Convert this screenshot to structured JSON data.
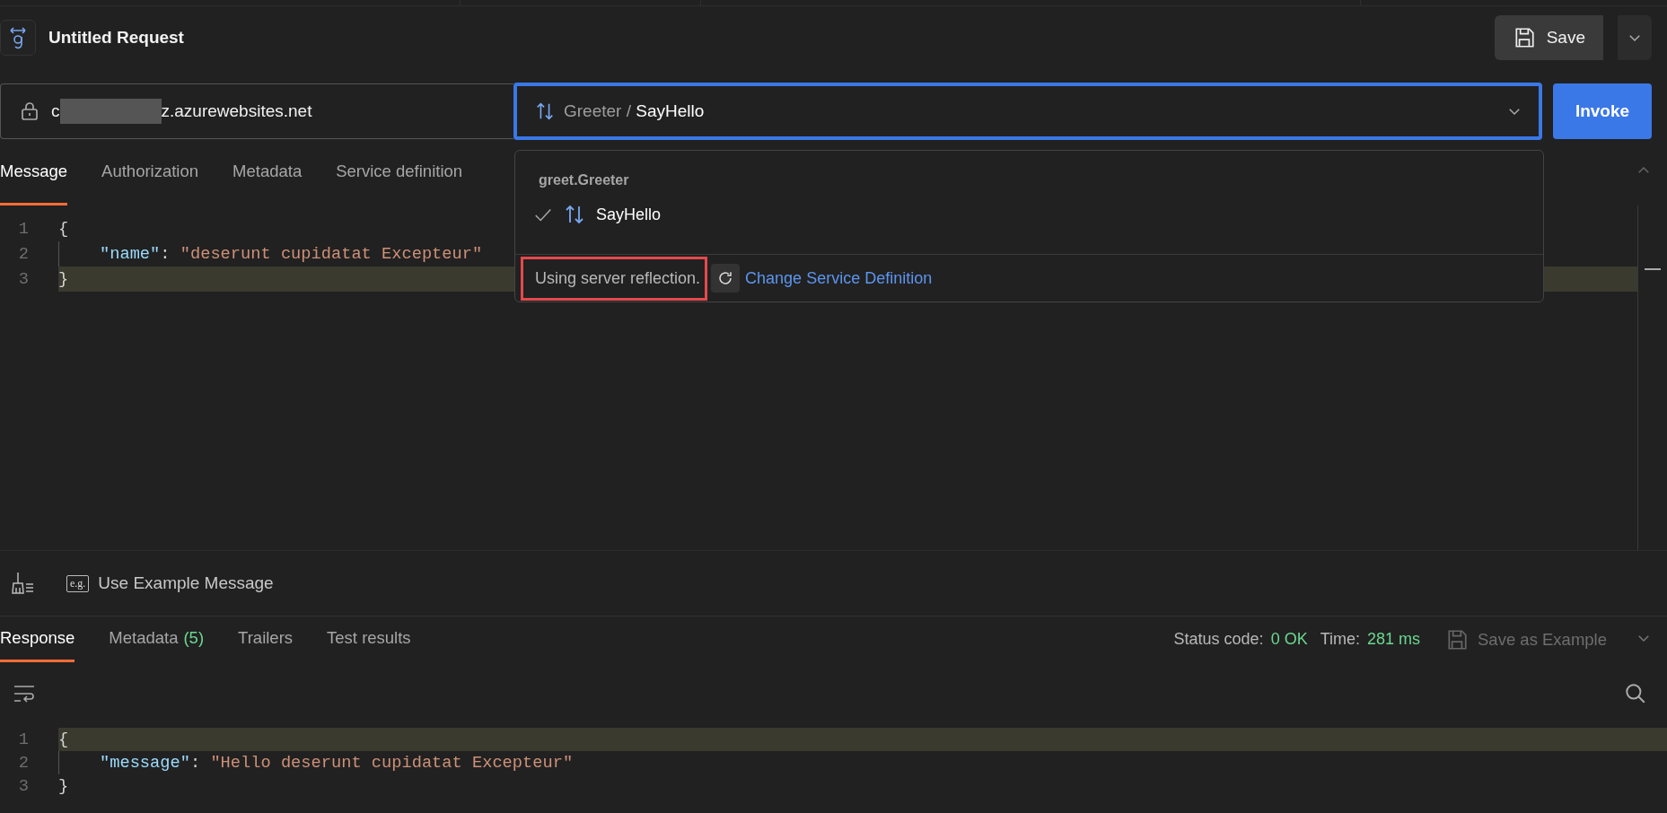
{
  "header": {
    "title": "Untitled Request",
    "save_label": "Save"
  },
  "request": {
    "url": {
      "start": "c",
      "redacted": true,
      "end": "z.azurewebsites.net"
    },
    "method": {
      "service": "Greeter",
      "separator": "/",
      "name": "SayHello"
    },
    "invoke_label": "Invoke"
  },
  "dropdown": {
    "group": "greet.Greeter",
    "items": [
      {
        "label": "SayHello",
        "selected": true
      }
    ],
    "footer": {
      "note": "Using server reflection.",
      "highlighted": true,
      "link": "Change Service Definition"
    }
  },
  "request_tabs": [
    {
      "label": "Message",
      "selected": true
    },
    {
      "label": "Authorization",
      "selected": false
    },
    {
      "label": "Metadata",
      "selected": false
    },
    {
      "label": "Service definition",
      "selected": false
    }
  ],
  "message_editor": {
    "lines": [
      {
        "number": "1",
        "highlighted": false,
        "indented": false,
        "tokens": [
          {
            "kind": "punct",
            "text": "{"
          }
        ]
      },
      {
        "number": "2",
        "highlighted": false,
        "indented": true,
        "tokens": [
          {
            "kind": "key",
            "text": "\"name\""
          },
          {
            "kind": "punct",
            "text": ": "
          },
          {
            "kind": "string",
            "text": "\"deserunt cupidatat Excepteur\""
          }
        ]
      },
      {
        "number": "3",
        "highlighted": true,
        "indented": false,
        "tokens": [
          {
            "kind": "punct",
            "text": "}"
          }
        ]
      }
    ]
  },
  "example_button": {
    "badge": "e.g.",
    "label": "Use Example Message"
  },
  "response_tabs": [
    {
      "label": "Response",
      "selected": true
    },
    {
      "label": "Metadata",
      "count": "(5)",
      "selected": false
    },
    {
      "label": "Trailers",
      "selected": false
    },
    {
      "label": "Test results",
      "selected": false
    }
  ],
  "status": {
    "code_label": "Status code:",
    "code": "0 OK",
    "time_label": "Time:",
    "time": "281 ms",
    "save_example": "Save as Example",
    "save_example_disabled": true
  },
  "response_editor": {
    "lines": [
      {
        "number": "1",
        "highlighted": true,
        "indented": false,
        "tokens": [
          {
            "kind": "punct",
            "text": "{"
          }
        ]
      },
      {
        "number": "2",
        "highlighted": false,
        "indented": true,
        "tokens": [
          {
            "kind": "key",
            "text": "\"message\""
          },
          {
            "kind": "punct",
            "text": ": "
          },
          {
            "kind": "string",
            "text": "\"Hello deserunt cupidatat Excepteur\""
          }
        ]
      },
      {
        "number": "3",
        "highlighted": false,
        "indented": false,
        "tokens": [
          {
            "kind": "punct",
            "text": "}"
          }
        ]
      }
    ]
  }
}
